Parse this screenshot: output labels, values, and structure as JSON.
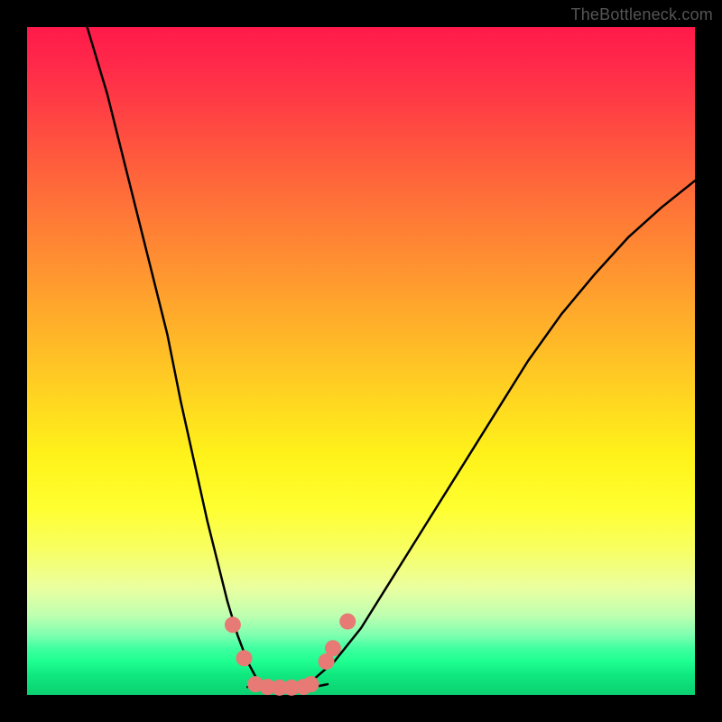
{
  "watermark": "TheBottleneck.com",
  "chart_data": {
    "type": "line",
    "title": "",
    "xlabel": "",
    "ylabel": "",
    "xlim": [
      0,
      100
    ],
    "ylim": [
      0,
      100
    ],
    "series": [
      {
        "name": "left-branch",
        "x": [
          9,
          12,
          15,
          18,
          21,
          23,
          25,
          27,
          28.5,
          30,
          31.5,
          33,
          34.5,
          36
        ],
        "values": [
          100,
          90,
          78,
          66,
          54,
          44,
          35,
          26,
          20,
          14,
          9,
          5,
          2.2,
          1.2
        ]
      },
      {
        "name": "flat-bottom",
        "x": [
          33,
          35,
          37,
          39,
          41,
          43,
          45
        ],
        "values": [
          1.2,
          1.0,
          0.9,
          0.9,
          1.0,
          1.2,
          1.6
        ]
      },
      {
        "name": "right-branch",
        "x": [
          40,
          43,
          46,
          50,
          55,
          60,
          65,
          70,
          75,
          80,
          85,
          90,
          95,
          100
        ],
        "values": [
          1.2,
          2.4,
          5,
          10,
          18,
          26,
          34,
          42,
          50,
          57,
          63,
          68.5,
          73,
          77
        ]
      }
    ],
    "markers": {
      "name": "highlight-points",
      "color": "#e77a74",
      "radius_px": 9,
      "points": [
        {
          "x": 30.8,
          "y": 10.5
        },
        {
          "x": 32.5,
          "y": 5.5
        },
        {
          "x": 34.2,
          "y": 1.6
        },
        {
          "x": 36.0,
          "y": 1.2
        },
        {
          "x": 37.8,
          "y": 1.1
        },
        {
          "x": 39.6,
          "y": 1.1
        },
        {
          "x": 41.4,
          "y": 1.2
        },
        {
          "x": 42.5,
          "y": 1.6
        },
        {
          "x": 44.8,
          "y": 5.0
        },
        {
          "x": 45.8,
          "y": 7.0
        },
        {
          "x": 48.0,
          "y": 11.0
        }
      ]
    }
  }
}
